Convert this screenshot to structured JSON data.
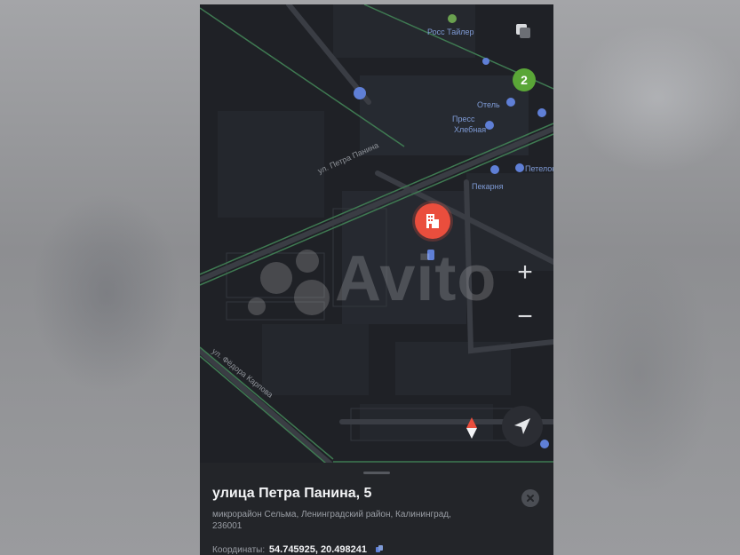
{
  "map": {
    "cluster_count": "2",
    "zoom_in_label": "+",
    "zoom_out_label": "−",
    "watermark": "Avito",
    "street_1": "ул. Петра Панина",
    "street_2": "ул. Фёдора Карпова",
    "poi_labels": [
      "Росс Тайлер",
      "Отель",
      "Пресс",
      "Хлебная",
      "Петелонга",
      "Пекарня"
    ]
  },
  "panel": {
    "title": "улица Петра Панина, 5",
    "subtitle": "микрорайон Сельма, Ленинградский район, Калининград, 236001",
    "coords_label": "Координаты:",
    "coords_value": "54.745925, 20.498241"
  },
  "colors": {
    "map_bg": "#1f2126",
    "road": "#3a3d44",
    "green_road": "#3f7a52",
    "pin": "#ea4e3d",
    "poi": "#5f7fd6",
    "badge": "#5aa637"
  }
}
